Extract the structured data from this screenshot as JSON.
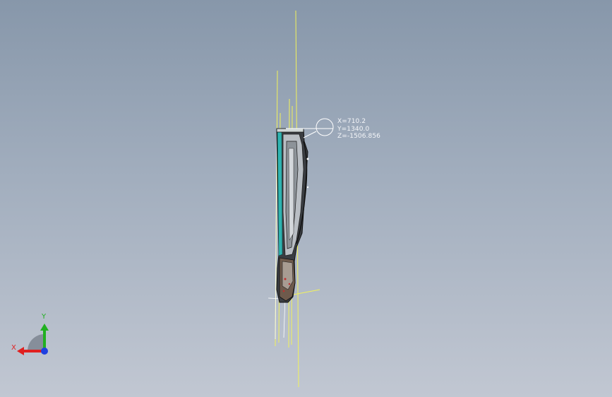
{
  "viewport": {
    "background_top": "#8797aa",
    "background_bottom": "#c1c7d2"
  },
  "coordinate_readout": {
    "x_text": "X=710.2",
    "y_text": "Y=1340.0",
    "z_text": "Z=-1506.856"
  },
  "triad": {
    "x_label": "X",
    "y_label": "Y",
    "x_color": "#e02020",
    "y_color": "#20b020",
    "z_color": "#2040e0"
  },
  "model": {
    "icon": "cad-part-side-view",
    "highlight_color": "#ffff66",
    "edge_color": "#1a1a1a",
    "accent_color": "#2fb3b0"
  }
}
